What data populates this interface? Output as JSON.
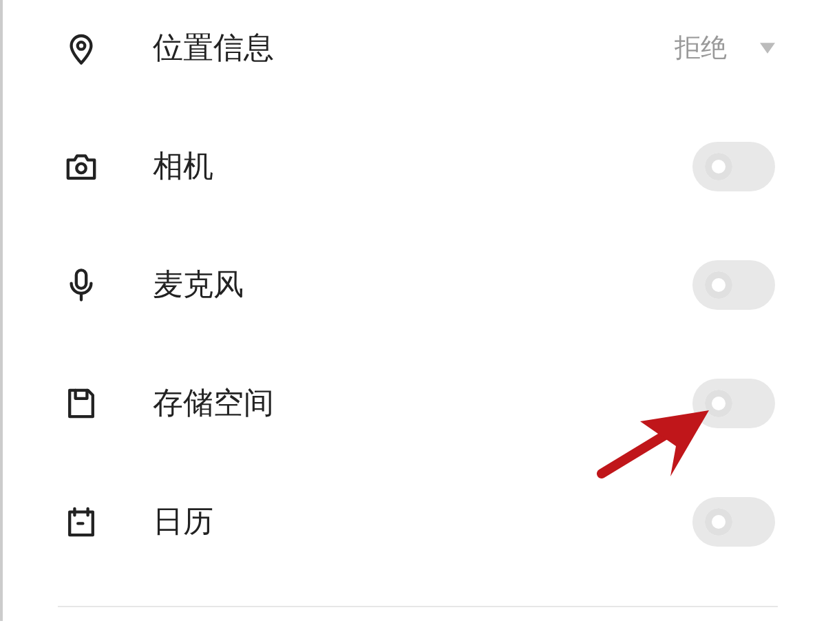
{
  "permissions": [
    {
      "kind": "dropdown",
      "label": "位置信息",
      "value": "拒绝"
    },
    {
      "kind": "toggle",
      "label": "相机",
      "on": false
    },
    {
      "kind": "toggle",
      "label": "麦克风",
      "on": false
    },
    {
      "kind": "toggle",
      "label": "存储空间",
      "on": false
    },
    {
      "kind": "toggle",
      "label": "日历",
      "on": false
    }
  ],
  "annotation": {
    "kind": "arrow",
    "color": "#c0161a"
  }
}
